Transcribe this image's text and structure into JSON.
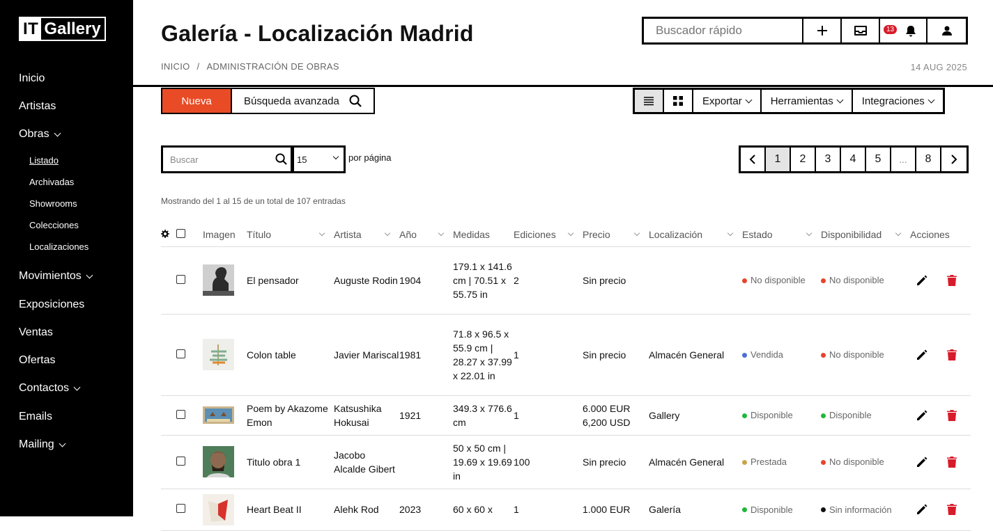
{
  "app": {
    "logo_it": "IT",
    "logo_gallery": "Gallery"
  },
  "sidebar": {
    "items": [
      {
        "label": "Inicio"
      },
      {
        "label": "Artistas"
      },
      {
        "label": "Obras"
      },
      {
        "label": "Movimientos"
      },
      {
        "label": "Exposiciones"
      },
      {
        "label": "Ventas"
      },
      {
        "label": "Ofertas"
      },
      {
        "label": "Contactos"
      },
      {
        "label": "Emails"
      },
      {
        "label": "Mailing"
      }
    ],
    "sub_items": [
      {
        "label": "Listado"
      },
      {
        "label": "Archivadas"
      },
      {
        "label": "Showrooms"
      },
      {
        "label": "Colecciones"
      },
      {
        "label": "Localizaciones"
      }
    ]
  },
  "header": {
    "title": "Galería - Localización Madrid",
    "breadcrumb": [
      "INICIO",
      "ADMINISTRACIÓN DE OBRAS"
    ],
    "breadcrumb_sep": "/",
    "date": "14 AUG 2025",
    "quick_search_placeholder": "Buscador rápido",
    "notifications_count": "13"
  },
  "toolbar": {
    "new_label": "Nueva",
    "advanced_search_label": "Búsqueda avanzada",
    "export_label": "Exportar",
    "tools_label": "Herramientas",
    "integrations_label": "Integraciones"
  },
  "filters": {
    "search_placeholder": "Buscar",
    "per_page_value": "15",
    "per_page_label": "por página"
  },
  "pagination": {
    "pages": [
      "1",
      "2",
      "3",
      "4",
      "5",
      "...",
      "8"
    ],
    "current": "1"
  },
  "summary": "Mostrando del 1 al 15 de un total de 107 entradas",
  "table": {
    "columns": [
      "Imagen",
      "Título",
      "Artista",
      "Año",
      "Medidas",
      "Ediciones",
      "Precio",
      "Localización",
      "Estado",
      "Disponibilidad",
      "Acciones"
    ],
    "rows": [
      {
        "title": "El pensador",
        "artist": "Auguste Rodin",
        "year": "1904",
        "measures": "179.1 x 141.6 cm | 70.51 x 55.75 in",
        "editions": "2",
        "price": "Sin precio",
        "location": "",
        "status": "No disponible",
        "status_color": "#e8442a",
        "availability": "No disponible",
        "availability_color": "#e8442a"
      },
      {
        "title": "Colon table",
        "artist": "Javier Mariscal",
        "year": "1981",
        "measures": "71.8 x 96.5 x 55.9 cm | 28.27 x 37.99 x 22.01 in",
        "editions": "1",
        "price": "Sin precio",
        "location": "Almacén General",
        "status": "Vendida",
        "status_color": "#4a6fd8",
        "availability": "No disponible",
        "availability_color": "#e8442a"
      },
      {
        "title": "Poem by Akazome Emon",
        "artist": "Katsushika Hokusai",
        "year": "1921",
        "measures": "349.3 x 776.6 cm",
        "editions": "1",
        "price": "6.000 EUR 6,200 USD",
        "location": "Gallery",
        "status": "Disponible",
        "status_color": "#1eb83a",
        "availability": "Disponible",
        "availability_color": "#1eb83a"
      },
      {
        "title": "Titulo obra 1",
        "artist": "Jacobo Alcalde Gibert",
        "year": "",
        "measures": "50 x 50 cm | 19.69 x 19.69 in",
        "editions": "100",
        "price": "Sin precio",
        "location": "Almacén General",
        "status": "Prestada",
        "status_color": "#c9a44a",
        "availability": "No disponible",
        "availability_color": "#e8442a"
      },
      {
        "title": "Heart Beat II",
        "artist": "Alehk Rod",
        "year": "2023",
        "measures": "60 x 60 x",
        "editions": "1",
        "price": "1.000 EUR",
        "location": "Galería",
        "status": "Disponible",
        "status_color": "#1eb83a",
        "availability": "Sin información",
        "availability_color": "#111111"
      }
    ]
  },
  "colors": {
    "accent": "#e84b25",
    "delete": "#d81b2b",
    "badge": "#d81b2b"
  }
}
